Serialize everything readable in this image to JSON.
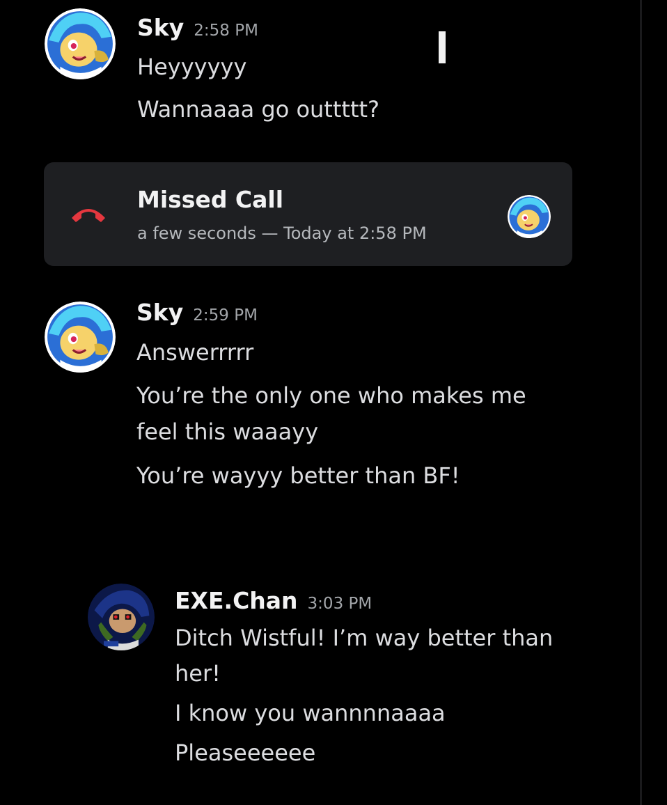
{
  "messages": [
    {
      "author": "Sky",
      "time": "2:58 PM",
      "lines": [
        "Heyyyyyy",
        "Wannaaaa go outtttt?"
      ]
    },
    {
      "author": "Sky",
      "time": "2:59 PM",
      "lines": [
        "Answerrrrr",
        "You’re the only one who makes me",
        "feel this waaayy",
        "You’re wayyy better than BF!"
      ]
    },
    {
      "author": "EXE.Chan",
      "time": "3:03 PM",
      "lines": [
        "Ditch Wistful! I’m way better than",
        "her!",
        "I know you wannnnaaaa",
        "Pleaseeeeee"
      ]
    }
  ],
  "missed_call": {
    "title": "Missed Call",
    "subtitle": "a few seconds — Today at 2:58 PM",
    "icon": "phone-hangup-icon",
    "icon_color": "#e5373f"
  },
  "colors": {
    "background": "#000000",
    "card": "#1e1f22",
    "timestamp": "#a3a6aa"
  }
}
